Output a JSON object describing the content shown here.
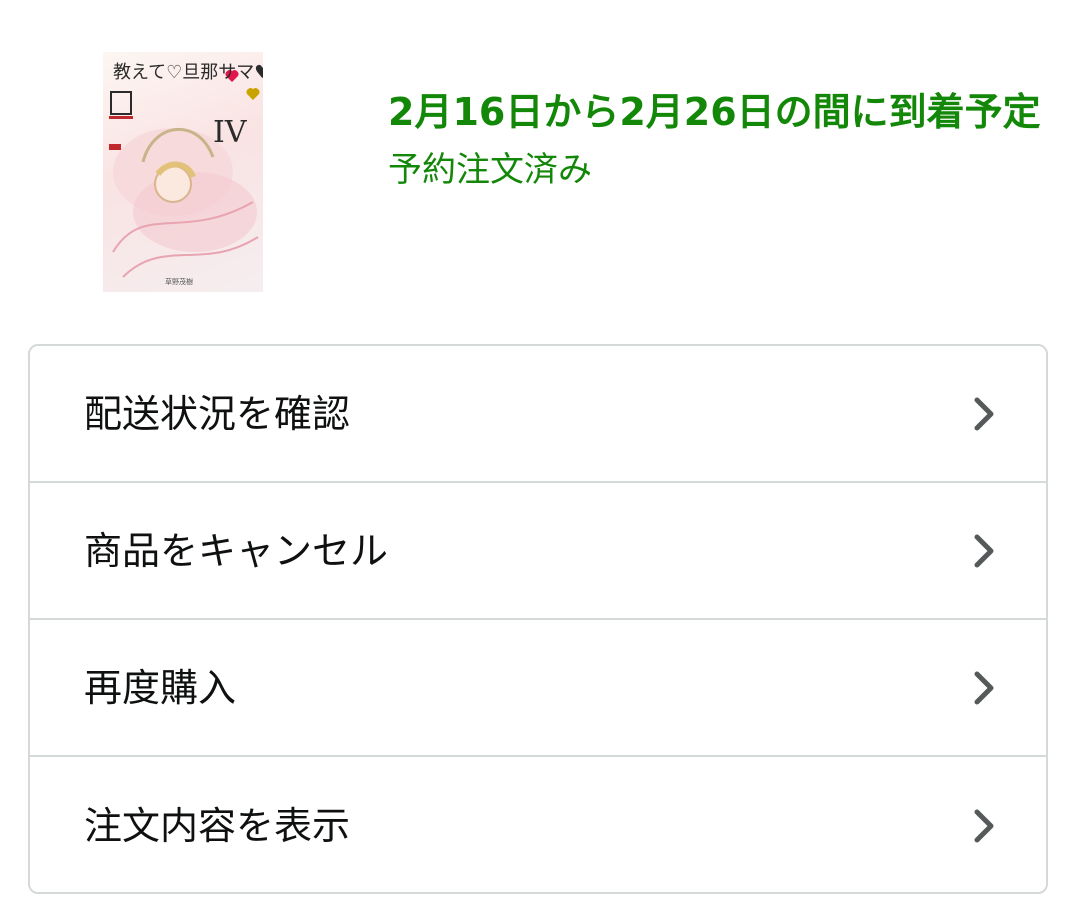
{
  "product": {
    "cover_title": "教えて♡旦那サマ♥",
    "cover_volume": "IV",
    "cover_publisher": "草野茂樹"
  },
  "delivery": {
    "date_text": "2月16日から2月26日の間に到着予定",
    "status_text": "予約注文済み",
    "accent_color": "#138808"
  },
  "actions": [
    {
      "label": "配送状況を確認",
      "icon": "chevron-right-icon"
    },
    {
      "label": "商品をキャンセル",
      "icon": "chevron-right-icon"
    },
    {
      "label": "再度購入",
      "icon": "chevron-right-icon"
    },
    {
      "label": "注文内容を表示",
      "icon": "chevron-right-icon"
    }
  ]
}
